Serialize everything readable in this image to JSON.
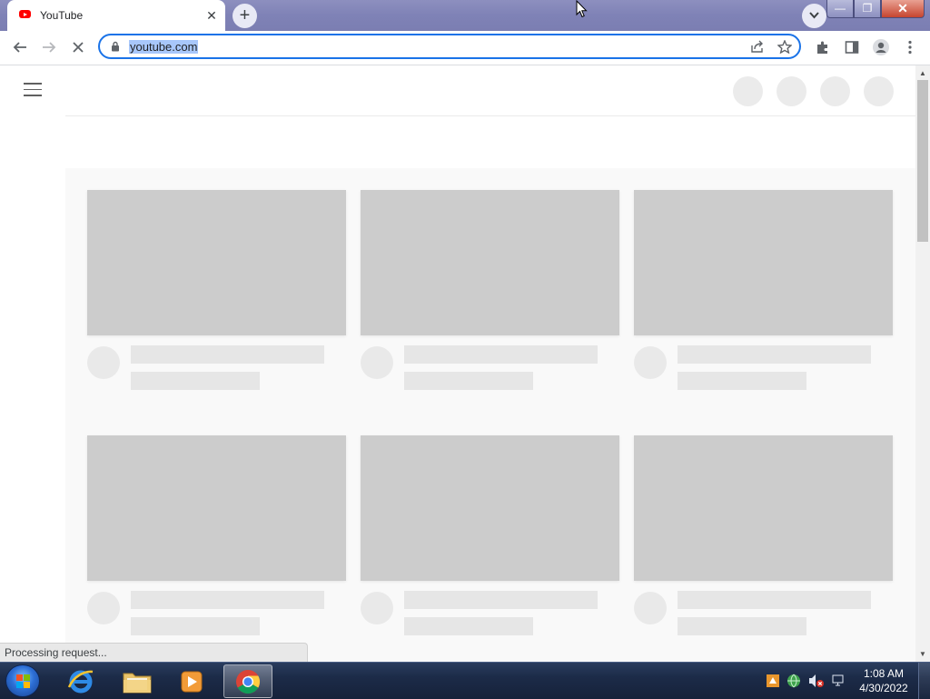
{
  "browser": {
    "tab": {
      "title": "YouTube"
    },
    "new_tab_label": "+",
    "address": {
      "url": "youtube.com"
    },
    "status_text": "Processing request..."
  },
  "taskbar": {
    "apps": [
      "Internet Explorer",
      "Windows Explorer",
      "Windows Media Player",
      "Google Chrome"
    ],
    "time": "1:08 AM",
    "date": "4/30/2022"
  },
  "colors": {
    "accent": "#1a73e8",
    "youtube_red": "#ff0000",
    "skeleton": "#cccccc"
  }
}
